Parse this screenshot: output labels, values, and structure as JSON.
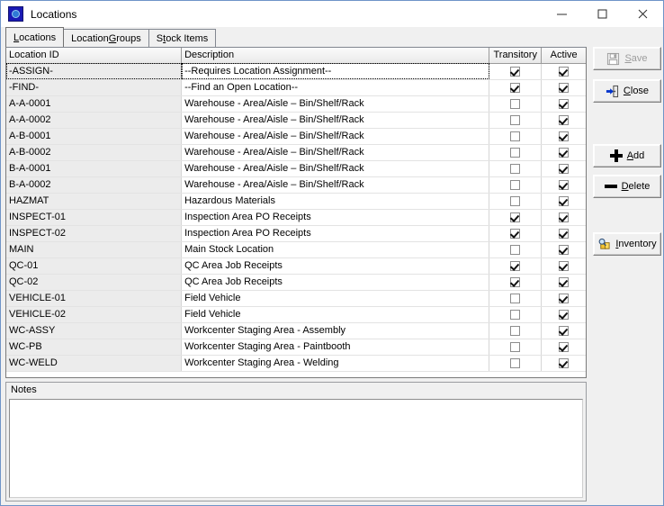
{
  "window": {
    "title": "Locations",
    "icon": "app-locations-icon",
    "controls": {
      "minimize": "minimize-icon",
      "maximize": "maximize-icon",
      "close": "close-icon"
    }
  },
  "tabs": [
    {
      "label": "Locations",
      "accel": "L",
      "active": true
    },
    {
      "label": "Location Groups",
      "accel": "G",
      "active": false
    },
    {
      "label": "Stock Items",
      "accel": "t",
      "active": false
    }
  ],
  "grid": {
    "columns": [
      "Location ID",
      "Description",
      "Transitory",
      "Active"
    ],
    "rows": [
      {
        "id": "-ASSIGN-",
        "description": "--Requires Location Assignment--",
        "transitory": true,
        "active": true,
        "selected": true
      },
      {
        "id": "-FIND-",
        "description": "--Find an Open Location--",
        "transitory": true,
        "active": true,
        "selected": false
      },
      {
        "id": "A-A-0001",
        "description": "Warehouse - Area/Aisle – Bin/Shelf/Rack",
        "transitory": false,
        "active": true,
        "selected": false
      },
      {
        "id": "A-A-0002",
        "description": "Warehouse - Area/Aisle – Bin/Shelf/Rack",
        "transitory": false,
        "active": true,
        "selected": false
      },
      {
        "id": "A-B-0001",
        "description": "Warehouse - Area/Aisle – Bin/Shelf/Rack",
        "transitory": false,
        "active": true,
        "selected": false
      },
      {
        "id": "A-B-0002",
        "description": "Warehouse - Area/Aisle – Bin/Shelf/Rack",
        "transitory": false,
        "active": true,
        "selected": false
      },
      {
        "id": "B-A-0001",
        "description": "Warehouse - Area/Aisle – Bin/Shelf/Rack",
        "transitory": false,
        "active": true,
        "selected": false
      },
      {
        "id": "B-A-0002",
        "description": "Warehouse - Area/Aisle – Bin/Shelf/Rack",
        "transitory": false,
        "active": true,
        "selected": false
      },
      {
        "id": "HAZMAT",
        "description": "Hazardous Materials",
        "transitory": false,
        "active": true,
        "selected": false
      },
      {
        "id": "INSPECT-01",
        "description": "Inspection Area PO Receipts",
        "transitory": true,
        "active": true,
        "selected": false
      },
      {
        "id": "INSPECT-02",
        "description": "Inspection Area PO Receipts",
        "transitory": true,
        "active": true,
        "selected": false
      },
      {
        "id": "MAIN",
        "description": "Main Stock Location",
        "transitory": false,
        "active": true,
        "selected": false
      },
      {
        "id": "QC-01",
        "description": "QC Area Job Receipts",
        "transitory": true,
        "active": true,
        "selected": false
      },
      {
        "id": "QC-02",
        "description": "QC Area Job Receipts",
        "transitory": true,
        "active": true,
        "selected": false
      },
      {
        "id": "VEHICLE-01",
        "description": "Field Vehicle",
        "transitory": false,
        "active": true,
        "selected": false
      },
      {
        "id": "VEHICLE-02",
        "description": "Field Vehicle",
        "transitory": false,
        "active": true,
        "selected": false
      },
      {
        "id": "WC-ASSY",
        "description": "Workcenter Staging Area - Assembly",
        "transitory": false,
        "active": true,
        "selected": false
      },
      {
        "id": "WC-PB",
        "description": "Workcenter Staging Area - Paintbooth",
        "transitory": false,
        "active": true,
        "selected": false
      },
      {
        "id": "WC-WELD",
        "description": "Workcenter Staging Area - Welding",
        "transitory": false,
        "active": true,
        "selected": false
      }
    ]
  },
  "notes": {
    "label": "Notes",
    "value": "",
    "placeholder": ""
  },
  "buttons": [
    {
      "key": "save",
      "label": "Save",
      "accel": "S",
      "icon": "floppy-disk-icon",
      "disabled": true
    },
    {
      "key": "close",
      "label": "Close",
      "accel": "C",
      "icon": "exit-door-icon",
      "disabled": false
    },
    {
      "key": "add",
      "label": "Add",
      "accel": "A",
      "icon": "plus-icon",
      "disabled": false
    },
    {
      "key": "delete",
      "label": "Delete",
      "accel": "D",
      "icon": "minus-icon",
      "disabled": false
    },
    {
      "key": "inventory",
      "label": "Inventory",
      "accel": "I",
      "icon": "magnifier-boxes-icon",
      "disabled": false
    }
  ],
  "colors": {
    "window_border": "#6f94c8",
    "face": "#f0f0f0",
    "grid_row_alt": "#ececec",
    "accent_blue": "#1a1ab4",
    "disabled_text": "#9d9d9d"
  }
}
